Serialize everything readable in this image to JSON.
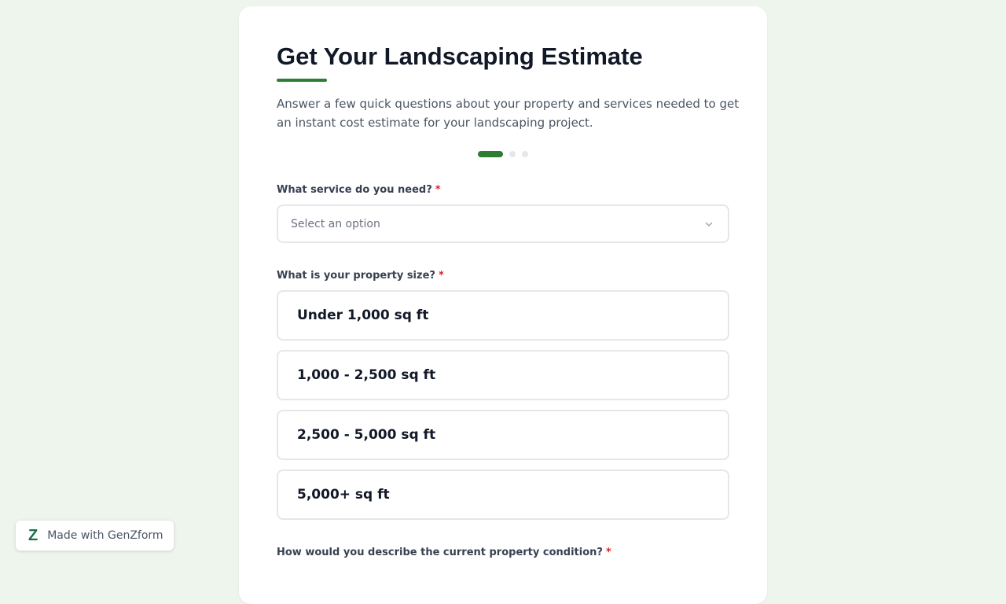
{
  "form": {
    "title": "Get Your Landscaping Estimate",
    "subtitle": "Answer a few quick questions about your property and services needed to get an instant cost estimate for your landscaping project.",
    "progress": {
      "current_step": 1,
      "total_steps": 3
    },
    "required_marker": "*",
    "service_question": {
      "label": "What service do you need?",
      "placeholder": "Select an option"
    },
    "size_question": {
      "label": "What is your property size?",
      "options": [
        "Under 1,000 sq ft",
        "1,000 - 2,500 sq ft",
        "2,500 - 5,000 sq ft",
        "5,000+ sq ft"
      ]
    },
    "condition_question": {
      "label": "How would you describe the current property condition?"
    }
  },
  "badge": {
    "logo": "Z",
    "text": "Made with GenZform"
  },
  "colors": {
    "accent": "#2e7d32",
    "background": "#eef5ec",
    "required": "#dc2626",
    "badge_logo": "#1b6e4a"
  },
  "icons": {
    "select_chevron": "chevron-down-icon",
    "badge_logo": "genzform-logo-icon"
  }
}
